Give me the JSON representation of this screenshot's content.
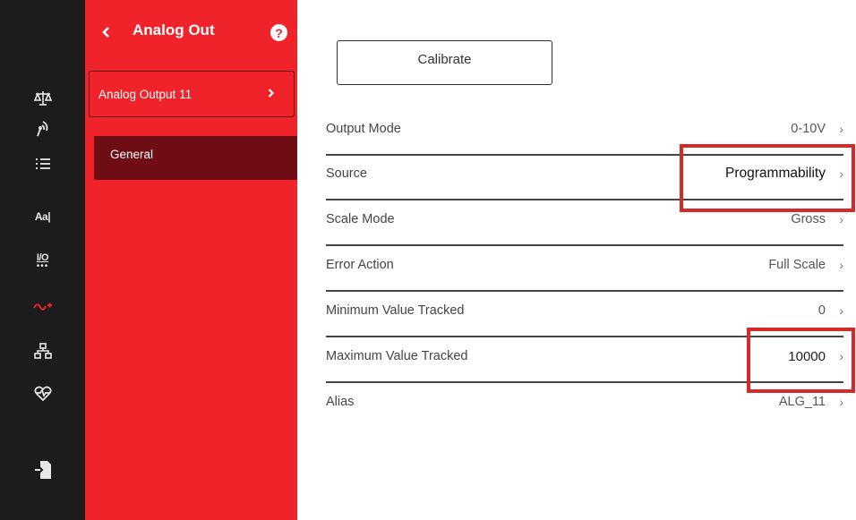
{
  "rail": {
    "items": [
      {
        "name": "scale",
        "icon": "scale-icon"
      },
      {
        "name": "wireless",
        "icon": "wireless-icon"
      },
      {
        "name": "list",
        "icon": "list-icon"
      },
      {
        "name": "text",
        "icon": "text-icon",
        "label": "Aa|"
      },
      {
        "name": "io",
        "icon": "io-icon",
        "label": "I/O"
      },
      {
        "name": "analog",
        "icon": "analog-out-icon",
        "active": true
      },
      {
        "name": "network",
        "icon": "network-icon"
      },
      {
        "name": "health",
        "icon": "heart-icon"
      },
      {
        "name": "export",
        "icon": "export-icon"
      }
    ],
    "active_color": "#e8232a"
  },
  "panel": {
    "title": "Analog Out",
    "help_label": "?",
    "output_select": "Analog Output 11",
    "nav_items": [
      "General"
    ]
  },
  "content": {
    "calibrate_label": "Calibrate",
    "rows": [
      {
        "label": "Output Mode",
        "value": "0-10V"
      },
      {
        "label": "Source",
        "value": "Programmability"
      },
      {
        "label": "Scale Mode",
        "value": "Gross"
      },
      {
        "label": "Error Action",
        "value": "Full Scale"
      },
      {
        "label": "Minimum Value Tracked",
        "value": "0"
      },
      {
        "label": "Maximum Value Tracked",
        "value": "10000"
      },
      {
        "label": "Alias",
        "value": "ALG_11"
      }
    ]
  },
  "colors": {
    "brand_red": "#f0222a",
    "nav_selected": "#6e0d14",
    "rail_bg": "#1c1c1c",
    "highlight": "#d62a2a"
  }
}
